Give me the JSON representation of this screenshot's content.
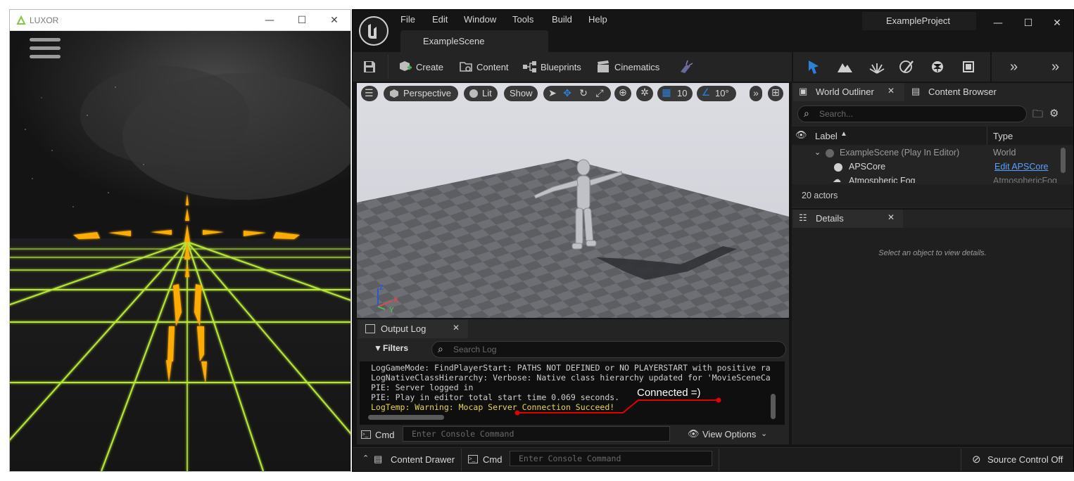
{
  "luxor": {
    "title": "LUXOR",
    "controls": {
      "minimize": "—",
      "maximize": "☐",
      "close": "✕"
    }
  },
  "unreal": {
    "menu": [
      "File",
      "Edit",
      "Window",
      "Tools",
      "Build",
      "Help"
    ],
    "project_name": "ExampleProject",
    "scene_tab": "ExampleScene",
    "window_controls": {
      "minimize": "—",
      "maximize": "☐",
      "close": "✕"
    },
    "toolbar": {
      "create": "Create",
      "content": "Content",
      "blueprints": "Blueprints",
      "cinematics": "Cinematics"
    },
    "viewport": {
      "perspective": "Perspective",
      "lit": "Lit",
      "show": "Show",
      "grid_snap": "10",
      "angle_snap": "10°",
      "axes": {
        "z": "Z",
        "x": "X",
        "y": "Y"
      }
    },
    "world_outliner": {
      "tab": "World Outliner",
      "content_browser_tab": "Content Browser",
      "search_placeholder": "Search...",
      "columns": {
        "label": "Label",
        "type": "Type"
      },
      "rows": [
        {
          "label": "ExampleScene (Play In Editor)",
          "type": "World"
        },
        {
          "label": "APSCore",
          "type": "Edit APSCore"
        },
        {
          "label": "Atmospheric Fog",
          "type": "AtmosphericFog"
        }
      ],
      "actor_count": "20 actors"
    },
    "details": {
      "tab": "Details",
      "empty_message": "Select an object to view details."
    },
    "output_log": {
      "tab": "Output Log",
      "filters": "Filters",
      "search_placeholder": "Search Log",
      "lines": [
        "LogGameMode: FindPlayerStart: PATHS NOT DEFINED or NO PLAYERSTART with positive ra",
        "LogNativeClassHierarchy: Verbose: Native class hierarchy updated for 'MovieSceneCa",
        "PIE: Server logged in",
        "PIE: Play in editor total start time 0.069 seconds."
      ],
      "warning_line": "LogTemp: Warning: Mocap Server Connection Succeed!",
      "annotation": "Connected =)",
      "cmd_label": "Cmd",
      "console_placeholder": "Enter Console Command",
      "view_options": "View Options"
    },
    "status_bar": {
      "content_drawer": "Content Drawer",
      "cmd_label": "Cmd",
      "console_placeholder": "Enter Console Command",
      "source_control": "Source Control Off"
    },
    "colors": {
      "accent_blue": "#2d7fd8",
      "warning_yellow": "#e8d44d",
      "annotation_red": "#e00000",
      "neon_grid": "#c8ff3a",
      "neon_orange": "#ffab00"
    }
  }
}
